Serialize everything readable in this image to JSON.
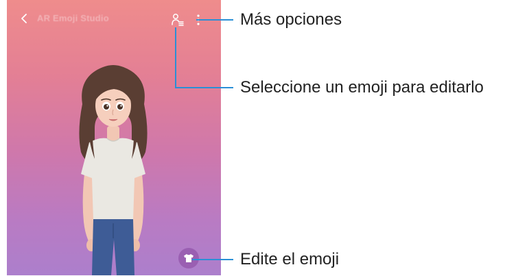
{
  "screen": {
    "app_title": "AR Emoji Studio",
    "back_icon": "chevron-left-icon",
    "select_emoji_icon": "person-list-icon",
    "more_icon": "more-vertical-icon",
    "edit_icon": "tshirt-icon"
  },
  "callouts": {
    "more_options": "Más opciones",
    "select_emoji": "Seleccione un emoji para editarlo",
    "edit_emoji": "Edite el emoji"
  },
  "colors": {
    "callout_line": "#2a8fd6",
    "background_top": "#ef8c8c",
    "background_bottom": "#ac7fcc",
    "edit_button": "#9a5fb2"
  }
}
